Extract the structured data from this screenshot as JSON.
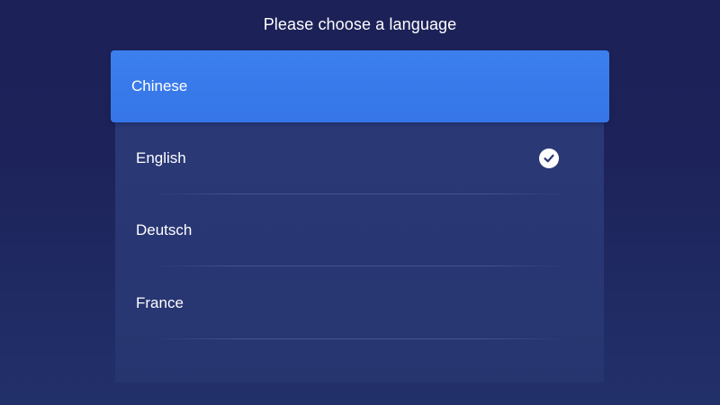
{
  "header": {
    "title": "Please choose a language"
  },
  "languages": {
    "items": [
      {
        "label": "Chinese",
        "focused": true,
        "checked": false
      },
      {
        "label": "English",
        "focused": false,
        "checked": true
      },
      {
        "label": "Deutsch",
        "focused": false,
        "checked": false
      },
      {
        "label": "France",
        "focused": false,
        "checked": false
      }
    ]
  },
  "icons": {
    "check": "check-circle-icon"
  },
  "colors": {
    "background": "#1c2157",
    "panel": "#2a3874",
    "focus": "#3a7bec",
    "check_mark": "#2a3874"
  }
}
